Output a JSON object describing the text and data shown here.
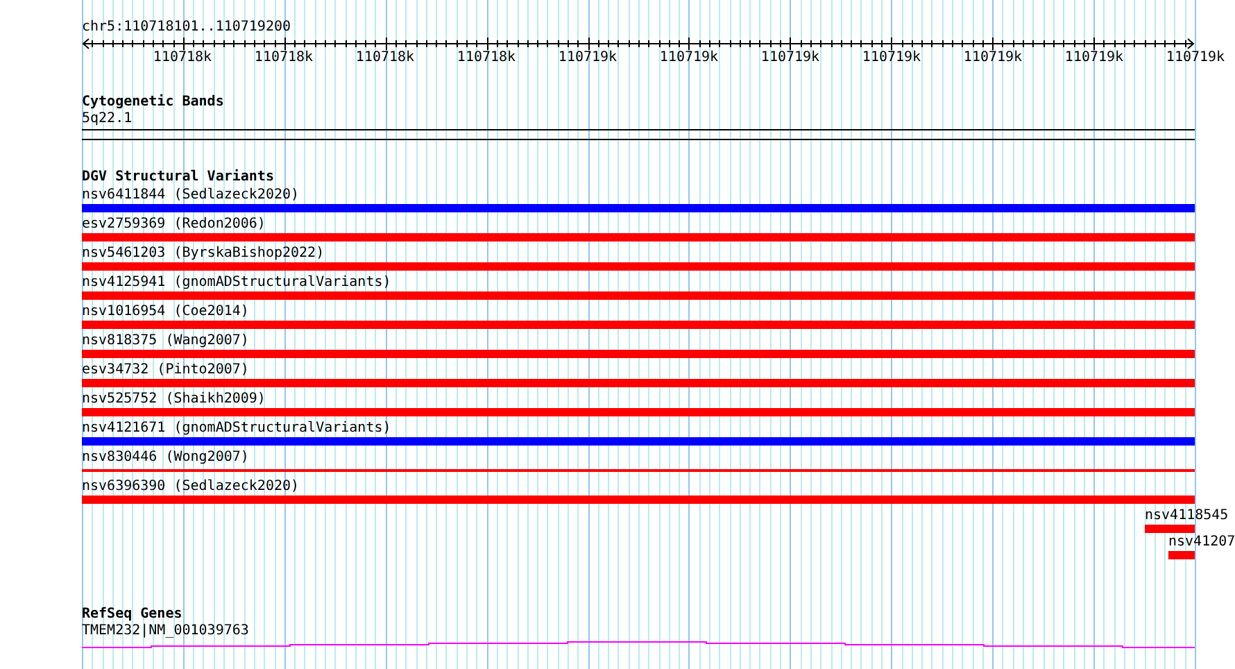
{
  "ruler": {
    "position": "chr5:110718101..110719200",
    "tick_labels": [
      "110718k",
      "110718k",
      "110718k",
      "110718k",
      "110719k",
      "110719k",
      "110719k",
      "110719k",
      "110719k",
      "110719k",
      "110719k"
    ]
  },
  "cytogenetic_bands": {
    "title": "Cytogenetic Bands",
    "band": "5q22.1"
  },
  "dgv_structural_variants": {
    "title": "DGV Structural Variants",
    "items": [
      {
        "label": "nsv6411844 (Sedlazeck2020)",
        "color": "#0000ff",
        "kind": "bar"
      },
      {
        "label": "esv2759369 (Redon2006)",
        "color": "#ff0000",
        "kind": "bar"
      },
      {
        "label": "nsv5461203 (ByrskaBishop2022)",
        "color": "#ff0000",
        "kind": "bar"
      },
      {
        "label": "nsv4125941 (gnomADStructuralVariants)",
        "color": "#ff0000",
        "kind": "bar"
      },
      {
        "label": "nsv1016954 (Coe2014)",
        "color": "#ff0000",
        "kind": "bar"
      },
      {
        "label": "nsv818375 (Wang2007)",
        "color": "#ff0000",
        "kind": "bar"
      },
      {
        "label": "esv34732 (Pinto2007)",
        "color": "#ff0000",
        "kind": "bar"
      },
      {
        "label": "nsv525752 (Shaikh2009)",
        "color": "#ff0000",
        "kind": "bar"
      },
      {
        "label": "nsv4121671 (gnomADStructuralVariants)",
        "color": "#0000ff",
        "kind": "bar"
      },
      {
        "label": "nsv830446 (Wong2007)",
        "color": "#ff0000",
        "kind": "line"
      },
      {
        "label": "nsv6396390 (Sedlazeck2020)",
        "color": "#ff0000",
        "kind": "bar"
      }
    ],
    "edge_items": [
      {
        "label": "nsv4118545",
        "color": "#ff0000"
      },
      {
        "label": "nsv41207",
        "color": "#ff0000"
      }
    ]
  },
  "refseq_genes": {
    "title": "RefSeq Genes",
    "gene": "TMEM232|NM_001039763"
  }
}
